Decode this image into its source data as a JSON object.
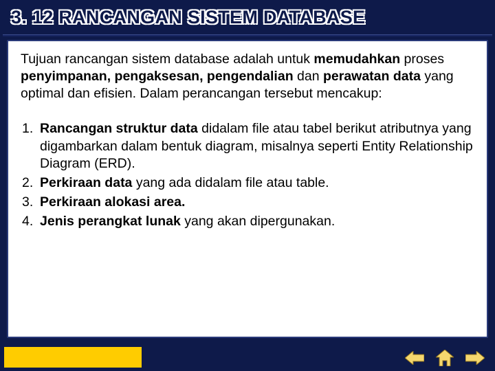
{
  "title": "3. 12 RANCANGAN SISTEM DATABASE",
  "intro": {
    "pre1": "Tujuan rancangan sistem database adalah untuk ",
    "b1": "memudahkan",
    "mid1": " proses ",
    "b2": "penyimpanan, pengaksesan, pengendalian",
    "mid2": " dan ",
    "b3": "perawatan data",
    "post": " yang optimal dan efisien. Dalam perancangan tersebut mencakup:"
  },
  "items": [
    {
      "num": "1.",
      "bold": "Rancangan struktur data",
      "rest": " didalam file atau tabel berikut atributnya yang digambarkan dalam bentuk diagram, misalnya seperti Entity Relationship Diagram (ERD)."
    },
    {
      "num": "2.",
      "bold": "Perkiraan data",
      "rest": " yang ada didalam file atau table."
    },
    {
      "num": "3.",
      "bold": "Perkiraan alokasi area.",
      "rest": ""
    },
    {
      "num": "4.",
      "bold": "Jenis perangkat lunak",
      "rest": " yang akan dipergunakan."
    }
  ],
  "colors": {
    "background": "#0e1a4a",
    "accent": "#ffcc00",
    "nav_fill": "#f5d76e",
    "nav_stroke": "#8a6d1a"
  }
}
